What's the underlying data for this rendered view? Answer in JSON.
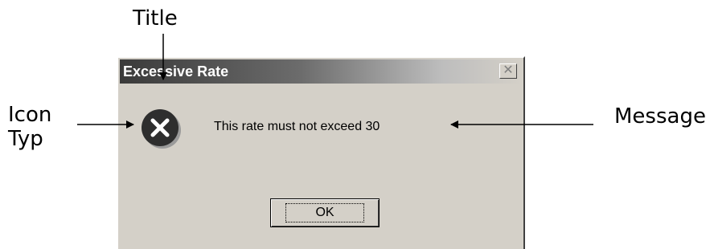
{
  "annotations": {
    "title_label": "Title",
    "icon_label_line1": "Icon",
    "icon_label_line2": "Typ",
    "message_label": "Message"
  },
  "dialog": {
    "title": "Excessive Rate",
    "message": "This rate must not exceed 30",
    "icon": "error-x-icon",
    "ok_label": "OK",
    "close_icon": "close-icon"
  },
  "colors": {
    "dialog_face": "#d4d0c8",
    "titlebar_dark": "#3a3a3a",
    "icon_fill": "#2e2e2e"
  }
}
